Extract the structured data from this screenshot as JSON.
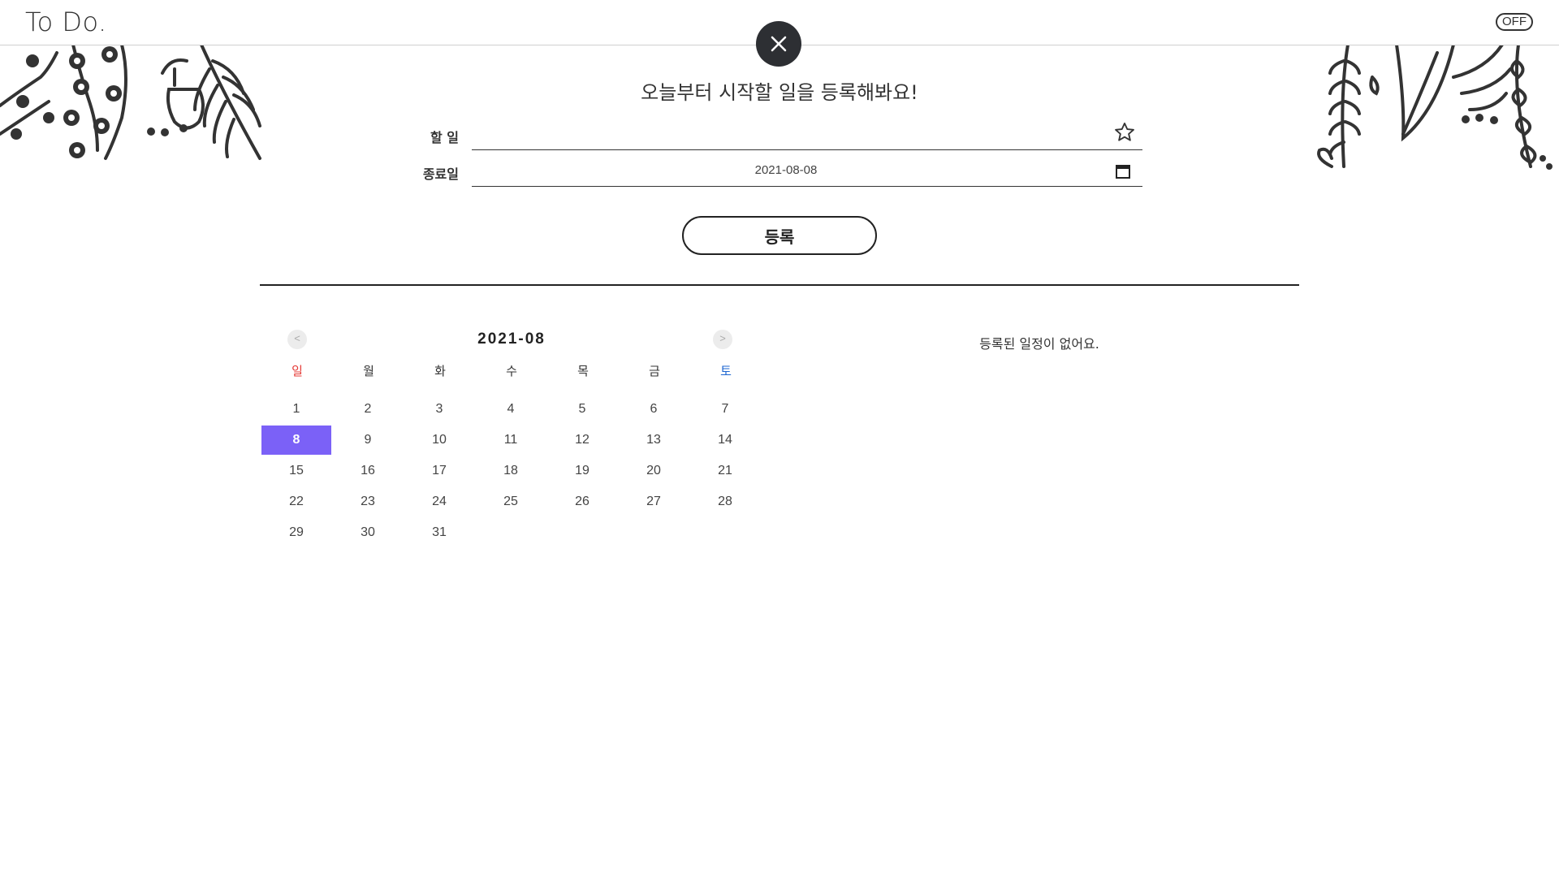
{
  "header": {
    "logo": "To Do.",
    "toggle_label": "OFF"
  },
  "form": {
    "headline": "오늘부터 시작할 일을 등록해봐요!",
    "task_label": "할 일",
    "task_value": "",
    "due_label": "종료일",
    "due_value": "2021-08-08",
    "submit_label": "등록",
    "icons": {
      "favorite": "star-icon",
      "date_picker": "calendar-icon",
      "close": "close-icon"
    }
  },
  "calendar": {
    "title": "2021-08",
    "prev_label": "<",
    "next_label": ">",
    "weekdays": [
      "일",
      "월",
      "화",
      "수",
      "목",
      "금",
      "토"
    ],
    "weeks": [
      [
        "1",
        "2",
        "3",
        "4",
        "5",
        "6",
        "7"
      ],
      [
        "8",
        "9",
        "10",
        "11",
        "12",
        "13",
        "14"
      ],
      [
        "15",
        "16",
        "17",
        "18",
        "19",
        "20",
        "21"
      ],
      [
        "22",
        "23",
        "24",
        "25",
        "26",
        "27",
        "28"
      ],
      [
        "29",
        "30",
        "31",
        "",
        "",
        "",
        ""
      ]
    ],
    "selected_day": "8"
  },
  "schedule": {
    "empty_message": "등록된 일정이 없어요."
  },
  "colors": {
    "accent": "#7b61f7",
    "sunday": "#e53935",
    "saturday": "#1e66d0",
    "dark": "#2d2f33"
  }
}
